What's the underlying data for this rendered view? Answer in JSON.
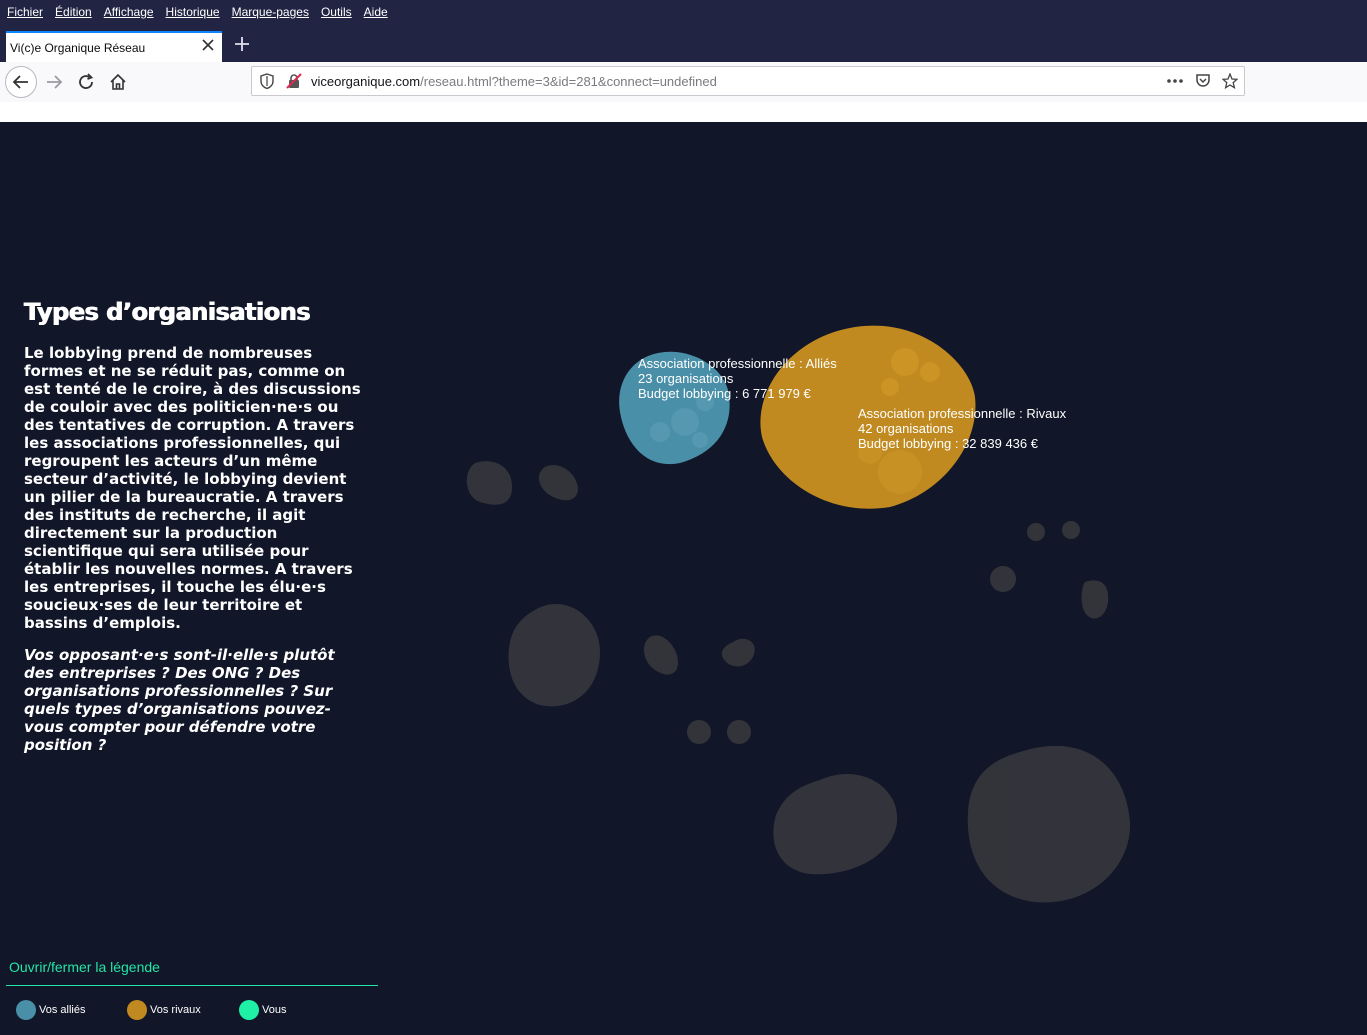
{
  "menu": [
    "Fichier",
    "Édition",
    "Affichage",
    "Historique",
    "Marque-pages",
    "Outils",
    "Aide"
  ],
  "tab": {
    "title": "Vi(c)e Organique Réseau"
  },
  "url": {
    "domain": "viceorganique.com",
    "path": "/reseau.html?theme=3&id=281&connect=undefined"
  },
  "intro": {
    "title": "Types d’organisations",
    "body": "Le lobbying prend de nombreuses formes et ne se réduit pas, comme on est tenté de le croire, à des discussions de couloir avec des politicien·ne·s ou des tentatives de corruption. A travers les associations professionnelles, qui regroupent les acteurs d’un même secteur d’activité, le lobbying devient un pilier de la bureaucratie. A travers des instituts de recherche, il agit directement sur la production scientifique qui sera utilisée pour établir les nouvelles normes. A travers les entreprises, il touche les élu·e·s soucieux·ses de leur territoire et bassins d’emplois.",
    "question": "Vos opposant·e·s sont-il·elle·s plutôt des entreprises ? Des ONG ? Des organisations professionnelles ? Sur quels types d’organisations pouvez-vous compter pour défendre votre position ?"
  },
  "clusters": {
    "allies": {
      "name": "Association professionnelle : Alliés",
      "count": "23 organisations",
      "budget": "Budget lobbying : 6 771 979 €"
    },
    "rivals": {
      "name": "Association professionnelle : Rivaux",
      "count": "42 organisations",
      "budget": "Budget lobbying : 32 839 436 €"
    }
  },
  "legend": {
    "toggle": "Ouvrir/fermer la légende",
    "items": [
      {
        "label": "Vos alliés",
        "color": "#4a8fa8"
      },
      {
        "label": "Vos rivaux",
        "color": "#c08a20"
      },
      {
        "label": "Vous",
        "color": "#1ef0a6"
      }
    ]
  },
  "colors": {
    "background": "#111628",
    "allies": "#4a8fa8",
    "rivals": "#c08a20",
    "inactive": "#3a3a3e",
    "accent": "#23e6a6"
  }
}
